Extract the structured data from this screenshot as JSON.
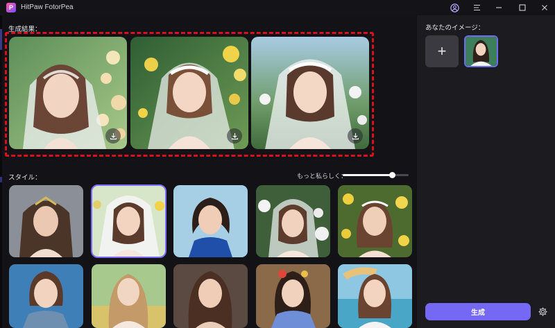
{
  "app": {
    "title": "HitPaw FotorPea",
    "logo_letter": "P"
  },
  "titlebar_icons": [
    "account-icon",
    "menu-icon",
    "minimize-icon",
    "maximize-icon",
    "close-icon"
  ],
  "results": {
    "label": "生成結果：",
    "images": [
      {
        "name": "result-image-1",
        "bg": "#7fb06a"
      },
      {
        "name": "result-image-2",
        "bg": "#3f6e3c"
      },
      {
        "name": "result-image-3",
        "bg": "#8fbad8"
      }
    ],
    "highlight_color": "#d6121b"
  },
  "styles": {
    "label": "スタイル：",
    "strength_label": "もっと私らしく：",
    "strength_value": 0.75,
    "selected_index": 1
  },
  "sidebar": {
    "your_image_label": "あなたのイメージ：",
    "add_icon": "plus-icon",
    "generate_label": "生成",
    "settings_icon": "gear-icon"
  },
  "colors": {
    "accent": "#7468f5",
    "selected_border": "#7c6cff"
  }
}
